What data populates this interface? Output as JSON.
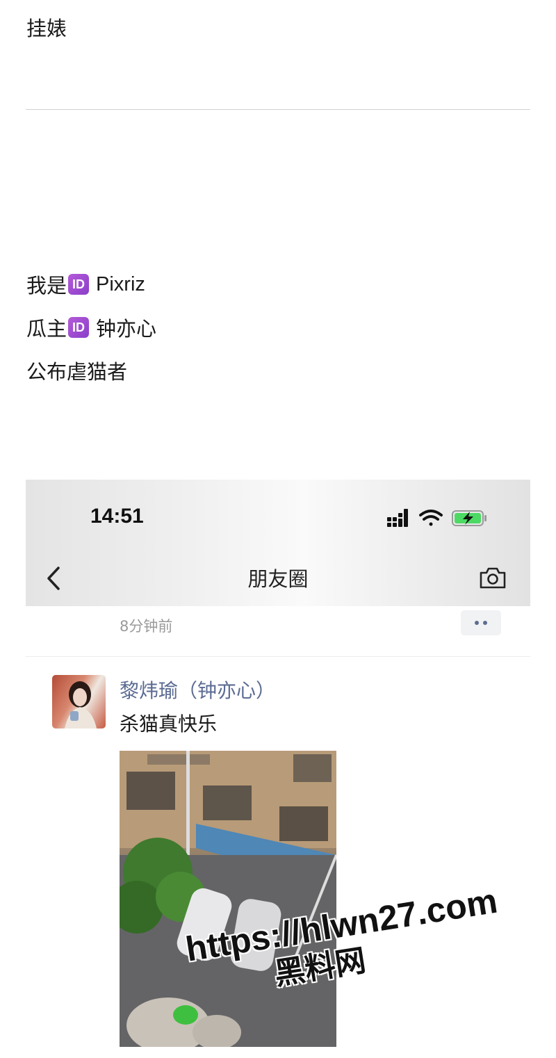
{
  "post": {
    "title": "挂婊",
    "lines": [
      {
        "prefix": "我是",
        "badge": "ID",
        "name": "Pixriz"
      },
      {
        "prefix": "瓜主",
        "badge": "ID",
        "name": "钟亦心"
      },
      {
        "text": "公布虐猫者"
      }
    ]
  },
  "screenshot": {
    "status_bar": {
      "time": "14:51",
      "icons": [
        "signal-icon",
        "wifi-icon",
        "battery-charging-icon"
      ]
    },
    "nav": {
      "title": "朋友圈",
      "back_icon": "chevron-left-icon",
      "camera_icon": "camera-icon"
    },
    "previous_post": {
      "time_ago": "8分钟前",
      "more_icon": "more-dots-icon"
    },
    "moment": {
      "author": "黎炜瑜（钟亦心）",
      "text": "杀猫真快乐"
    }
  },
  "watermark": {
    "url": "https://hlwn27.com",
    "brand": "黑料网"
  },
  "colors": {
    "link_name": "#5b6b92",
    "badge": "#9b4dd0",
    "battery": "#4cd964"
  }
}
